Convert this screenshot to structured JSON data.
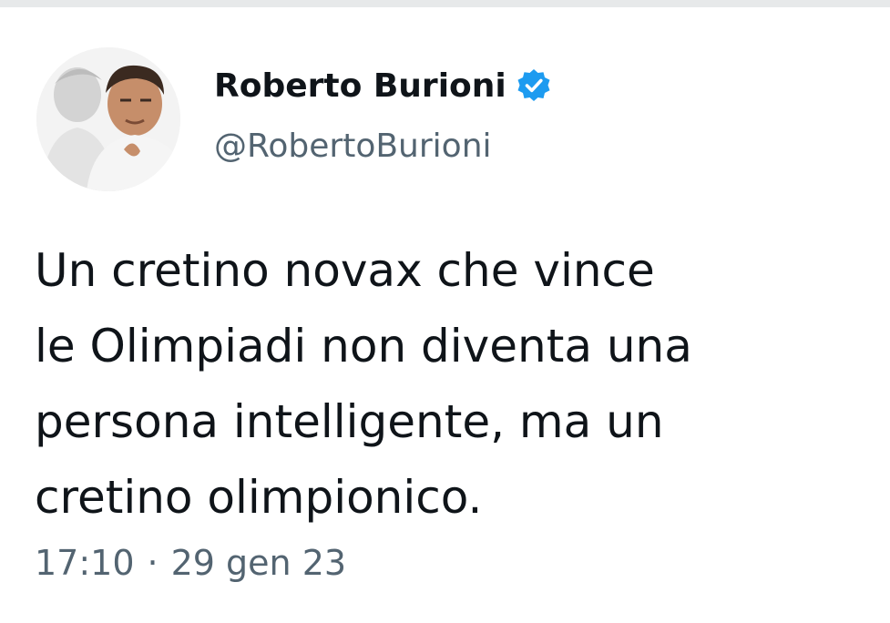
{
  "profile": {
    "display_name": "Roberto Burioni",
    "handle": "@RobertoBurioni",
    "avatar_icon": "profile-photo",
    "verified_icon": "verified-badge-icon",
    "verified_color": "#1d9bf0"
  },
  "tweet": {
    "lines": [
      "Un cretino novax che vince",
      "le Olimpiadi non diventa una",
      "persona intelligente, ma un",
      "cretino olimpionico."
    ],
    "time": "17:10",
    "separator": "·",
    "date": "29 gen 23"
  },
  "colors": {
    "text_primary": "#0f1419",
    "text_secondary": "#536471",
    "divider": "#e7e9ea"
  }
}
